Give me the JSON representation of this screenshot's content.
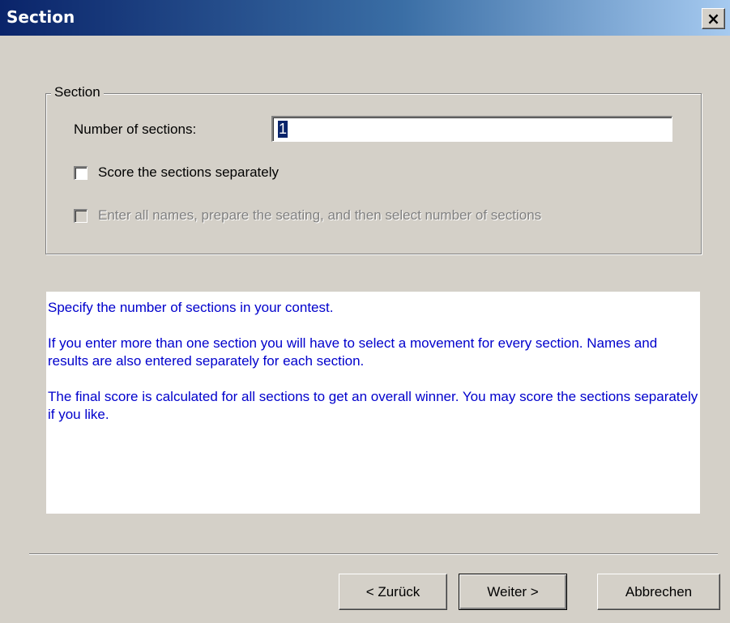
{
  "window": {
    "title": "Section"
  },
  "titlebar": {
    "close_glyph": "✕",
    "close_icon": "close-icon"
  },
  "section_group": {
    "legend": "Section",
    "number_label": "Number of sections:",
    "number_value": "1",
    "score_separately": {
      "label": "Score the sections separately",
      "checked": false
    },
    "enter_names_first": {
      "label": "Enter all names, prepare the seating, and then select number of sections",
      "checked": false,
      "enabled": false
    }
  },
  "info": {
    "paragraphs": [
      "Specify the number of sections in your contest.",
      "If you enter more than one section you will have to select a movement for every section. Names and results are also entered separately for each section.",
      "The final score is calculated for all sections to get an overall winner. You may score the sections separately if you like."
    ],
    "text_color": "#0000cc"
  },
  "buttons": {
    "back": "< Zurück",
    "next": "Weiter >",
    "cancel": "Abbrechen"
  },
  "colors": {
    "titlebar_start": "#0a246a",
    "titlebar_end": "#a6caf0",
    "dialog_bg": "#d4d0c8"
  }
}
